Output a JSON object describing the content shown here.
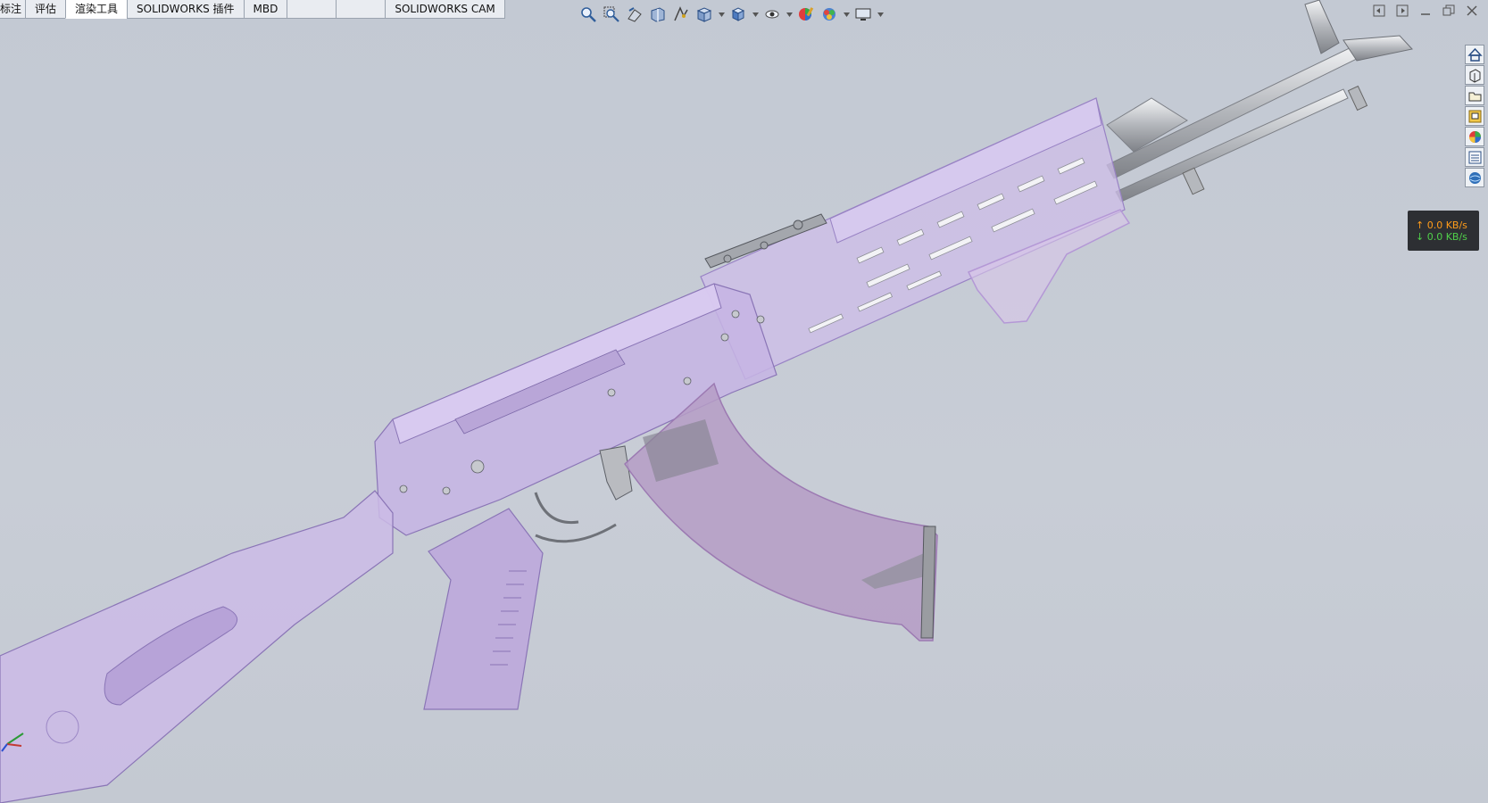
{
  "ribbon": {
    "tabs": [
      {
        "label": "标注"
      },
      {
        "label": "评估"
      },
      {
        "label": "渲染工具"
      },
      {
        "label": "SOLIDWORKS 插件"
      },
      {
        "label": "MBD"
      },
      {
        "label": ""
      },
      {
        "label": ""
      },
      {
        "label": "SOLIDWORKS CAM"
      }
    ],
    "active_tab": "渲染工具"
  },
  "heads_up_toolbar": {
    "icons": [
      "zoom-to-fit-icon",
      "zoom-to-area-icon",
      "previous-view-icon",
      "section-view-icon",
      "dynamic-annotation-icon",
      "view-orientation-icon",
      "display-style-icon",
      "hide-show-items-icon",
      "edit-appearance-icon",
      "apply-scene-icon",
      "view-settings-icon"
    ]
  },
  "window_controls": {
    "icons": [
      "tile-left-icon",
      "tile-right-icon",
      "minimize-icon",
      "restore-icon",
      "close-icon"
    ]
  },
  "task_pane": {
    "icons": [
      "home-icon",
      "design-library-icon",
      "file-explorer-icon",
      "view-palette-icon",
      "appearances-icon",
      "custom-properties-icon",
      "solidworks-forum-icon"
    ]
  },
  "net_speed": {
    "upload": "0.0 KB/s",
    "download": "0.0 KB/s"
  },
  "colors": {
    "viewport": "#c6ccd6",
    "model_translucent": "#c8b6e4",
    "model_stroke": "#8b77b3",
    "metal": "#b5b8bd"
  }
}
